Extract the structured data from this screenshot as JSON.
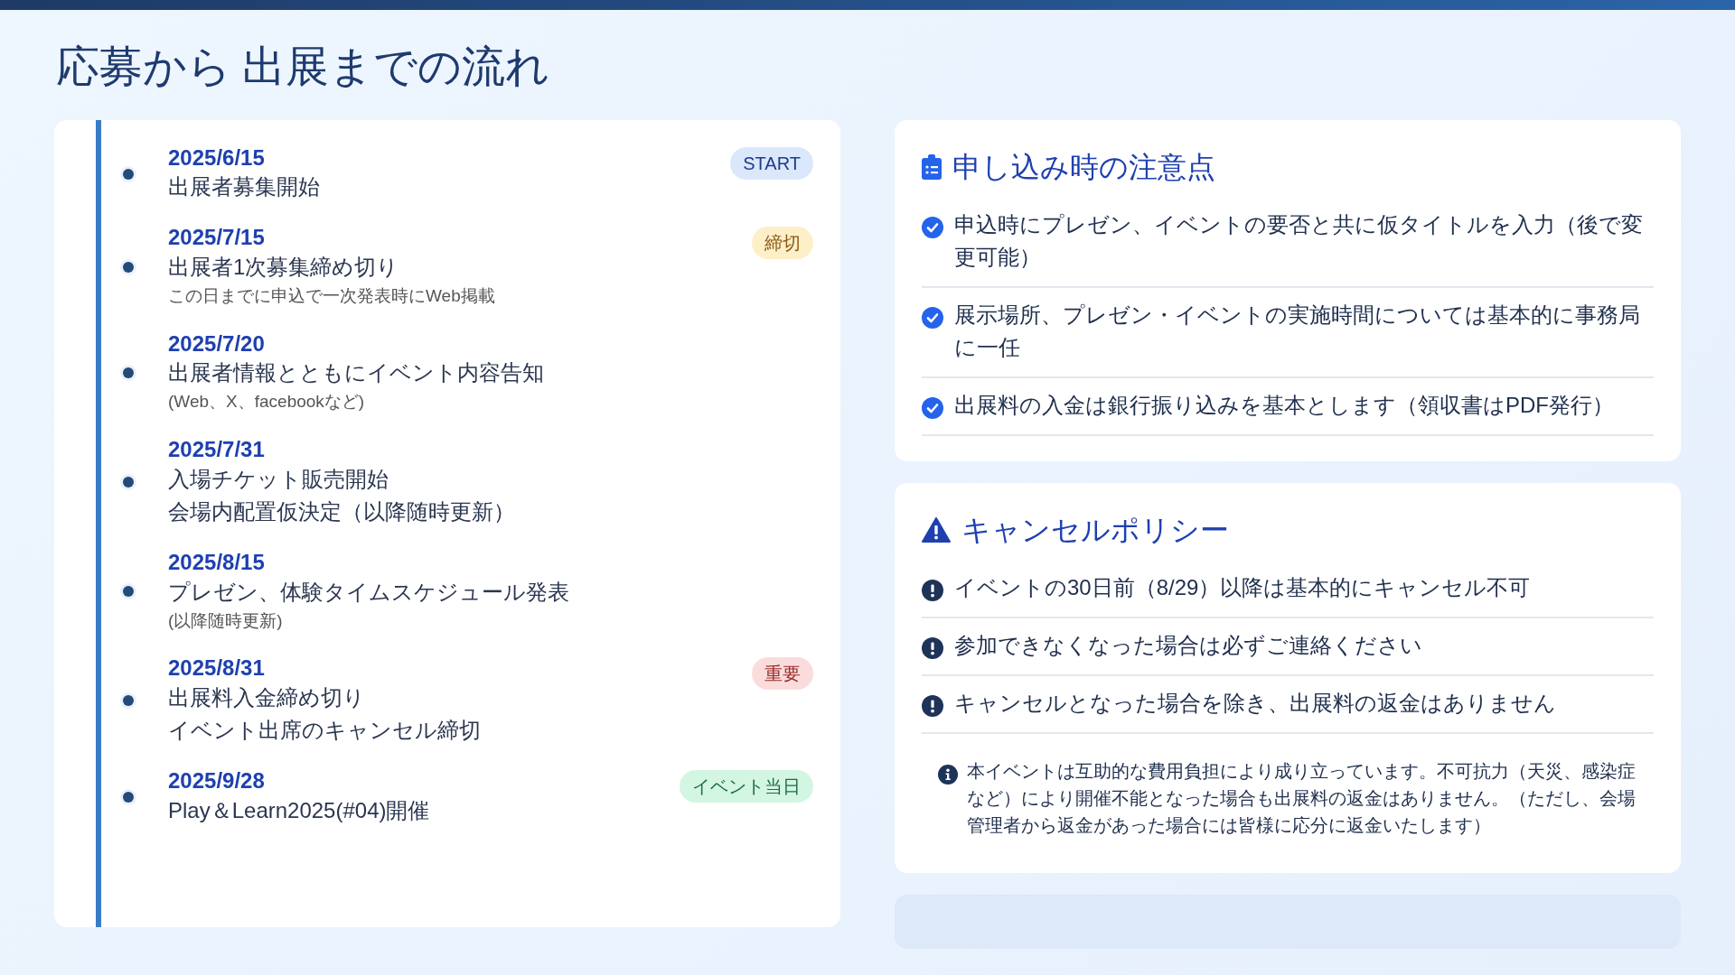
{
  "title": "応募から 出展までの流れ",
  "timeline": [
    {
      "date": "2025/6/15",
      "badge": {
        "text": "START",
        "kind": "start"
      },
      "lines": [
        {
          "text": "出展者募集開始",
          "kind": "main"
        }
      ]
    },
    {
      "date": "2025/7/15",
      "badge": {
        "text": "締切",
        "kind": "deadline"
      },
      "lines": [
        {
          "text": "出展者1次募集締め切り",
          "kind": "main"
        },
        {
          "text": "この日までに申込で一次発表時にWeb掲載",
          "kind": "note"
        }
      ]
    },
    {
      "date": "2025/7/20",
      "lines": [
        {
          "text": "出展者情報とともにイベント内容告知",
          "kind": "main"
        },
        {
          "text": "(Web、X、facebookなど)",
          "kind": "note"
        }
      ]
    },
    {
      "date": "2025/7/31",
      "lines": [
        {
          "text": "入場チケット販売開始",
          "kind": "main"
        },
        {
          "text": "会場内配置仮決定（以降随時更新）",
          "kind": "main"
        }
      ]
    },
    {
      "date": "2025/8/15",
      "lines": [
        {
          "text": "プレゼン、体験タイムスケジュール発表",
          "kind": "main"
        },
        {
          "text": "(以降随時更新)",
          "kind": "note"
        }
      ]
    },
    {
      "date": "2025/8/31",
      "badge": {
        "text": "重要",
        "kind": "important"
      },
      "lines": [
        {
          "text": "出展料入金締め切り",
          "kind": "main"
        },
        {
          "text": "イベント出席のキャンセル締切",
          "kind": "main"
        }
      ]
    },
    {
      "date": "2025/9/28",
      "badge": {
        "text": "イベント当日",
        "kind": "event"
      },
      "lines": [
        {
          "text": "Play＆Learn2025(#04)開催",
          "kind": "main"
        }
      ]
    }
  ],
  "panels": [
    {
      "kind": "notes",
      "heading": "申し込み時の注意点",
      "items": [
        {
          "text": "申込時にプレゼン、イベントの要否と共に仮タイトルを入力（後で変更可能）"
        },
        {
          "text": "展示場所、プレゼン・イベントの実施時間については基本的に事務局に一任"
        },
        {
          "text": "出展料の入金は銀行振り込みを基本とします（領収書はPDF発行）"
        }
      ]
    },
    {
      "kind": "cancel",
      "heading": "キャンセルポリシー",
      "items": [
        {
          "text": "イベントの30日前（8/29）以降は基本的にキャンセル不可"
        },
        {
          "text": "参加できなくなった場合は必ずご連絡ください"
        },
        {
          "text": "キャンセルとなった場合を除き、出展料の返金はありません"
        }
      ],
      "info": "本イベントは互助的な費用負担により成り立っています。不可抗力（天災、感染症など）により開催不能となった場合も出展料の返金はありません。（ただし、会場管理者から返金があった場合には皆様に応分に返金いたします）"
    }
  ]
}
